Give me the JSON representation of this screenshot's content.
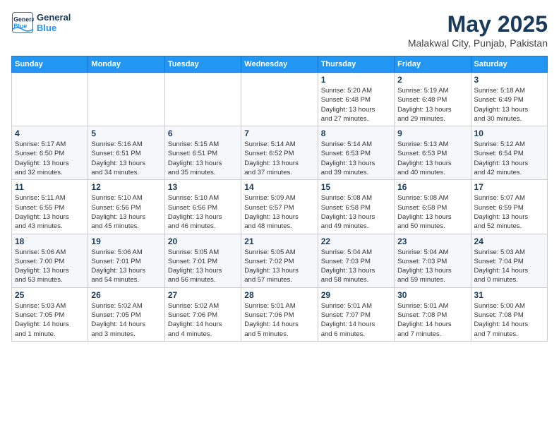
{
  "header": {
    "logo_line1": "General",
    "logo_line2": "Blue",
    "month": "May 2025",
    "location": "Malakwal City, Punjab, Pakistan"
  },
  "weekdays": [
    "Sunday",
    "Monday",
    "Tuesday",
    "Wednesday",
    "Thursday",
    "Friday",
    "Saturday"
  ],
  "weeks": [
    [
      {
        "num": "",
        "info": ""
      },
      {
        "num": "",
        "info": ""
      },
      {
        "num": "",
        "info": ""
      },
      {
        "num": "",
        "info": ""
      },
      {
        "num": "1",
        "info": "Sunrise: 5:20 AM\nSunset: 6:48 PM\nDaylight: 13 hours\nand 27 minutes."
      },
      {
        "num": "2",
        "info": "Sunrise: 5:19 AM\nSunset: 6:48 PM\nDaylight: 13 hours\nand 29 minutes."
      },
      {
        "num": "3",
        "info": "Sunrise: 5:18 AM\nSunset: 6:49 PM\nDaylight: 13 hours\nand 30 minutes."
      }
    ],
    [
      {
        "num": "4",
        "info": "Sunrise: 5:17 AM\nSunset: 6:50 PM\nDaylight: 13 hours\nand 32 minutes."
      },
      {
        "num": "5",
        "info": "Sunrise: 5:16 AM\nSunset: 6:51 PM\nDaylight: 13 hours\nand 34 minutes."
      },
      {
        "num": "6",
        "info": "Sunrise: 5:15 AM\nSunset: 6:51 PM\nDaylight: 13 hours\nand 35 minutes."
      },
      {
        "num": "7",
        "info": "Sunrise: 5:14 AM\nSunset: 6:52 PM\nDaylight: 13 hours\nand 37 minutes."
      },
      {
        "num": "8",
        "info": "Sunrise: 5:14 AM\nSunset: 6:53 PM\nDaylight: 13 hours\nand 39 minutes."
      },
      {
        "num": "9",
        "info": "Sunrise: 5:13 AM\nSunset: 6:53 PM\nDaylight: 13 hours\nand 40 minutes."
      },
      {
        "num": "10",
        "info": "Sunrise: 5:12 AM\nSunset: 6:54 PM\nDaylight: 13 hours\nand 42 minutes."
      }
    ],
    [
      {
        "num": "11",
        "info": "Sunrise: 5:11 AM\nSunset: 6:55 PM\nDaylight: 13 hours\nand 43 minutes."
      },
      {
        "num": "12",
        "info": "Sunrise: 5:10 AM\nSunset: 6:56 PM\nDaylight: 13 hours\nand 45 minutes."
      },
      {
        "num": "13",
        "info": "Sunrise: 5:10 AM\nSunset: 6:56 PM\nDaylight: 13 hours\nand 46 minutes."
      },
      {
        "num": "14",
        "info": "Sunrise: 5:09 AM\nSunset: 6:57 PM\nDaylight: 13 hours\nand 48 minutes."
      },
      {
        "num": "15",
        "info": "Sunrise: 5:08 AM\nSunset: 6:58 PM\nDaylight: 13 hours\nand 49 minutes."
      },
      {
        "num": "16",
        "info": "Sunrise: 5:08 AM\nSunset: 6:58 PM\nDaylight: 13 hours\nand 50 minutes."
      },
      {
        "num": "17",
        "info": "Sunrise: 5:07 AM\nSunset: 6:59 PM\nDaylight: 13 hours\nand 52 minutes."
      }
    ],
    [
      {
        "num": "18",
        "info": "Sunrise: 5:06 AM\nSunset: 7:00 PM\nDaylight: 13 hours\nand 53 minutes."
      },
      {
        "num": "19",
        "info": "Sunrise: 5:06 AM\nSunset: 7:01 PM\nDaylight: 13 hours\nand 54 minutes."
      },
      {
        "num": "20",
        "info": "Sunrise: 5:05 AM\nSunset: 7:01 PM\nDaylight: 13 hours\nand 56 minutes."
      },
      {
        "num": "21",
        "info": "Sunrise: 5:05 AM\nSunset: 7:02 PM\nDaylight: 13 hours\nand 57 minutes."
      },
      {
        "num": "22",
        "info": "Sunrise: 5:04 AM\nSunset: 7:03 PM\nDaylight: 13 hours\nand 58 minutes."
      },
      {
        "num": "23",
        "info": "Sunrise: 5:04 AM\nSunset: 7:03 PM\nDaylight: 13 hours\nand 59 minutes."
      },
      {
        "num": "24",
        "info": "Sunrise: 5:03 AM\nSunset: 7:04 PM\nDaylight: 14 hours\nand 0 minutes."
      }
    ],
    [
      {
        "num": "25",
        "info": "Sunrise: 5:03 AM\nSunset: 7:05 PM\nDaylight: 14 hours\nand 1 minute."
      },
      {
        "num": "26",
        "info": "Sunrise: 5:02 AM\nSunset: 7:05 PM\nDaylight: 14 hours\nand 3 minutes."
      },
      {
        "num": "27",
        "info": "Sunrise: 5:02 AM\nSunset: 7:06 PM\nDaylight: 14 hours\nand 4 minutes."
      },
      {
        "num": "28",
        "info": "Sunrise: 5:01 AM\nSunset: 7:06 PM\nDaylight: 14 hours\nand 5 minutes."
      },
      {
        "num": "29",
        "info": "Sunrise: 5:01 AM\nSunset: 7:07 PM\nDaylight: 14 hours\nand 6 minutes."
      },
      {
        "num": "30",
        "info": "Sunrise: 5:01 AM\nSunset: 7:08 PM\nDaylight: 14 hours\nand 7 minutes."
      },
      {
        "num": "31",
        "info": "Sunrise: 5:00 AM\nSunset: 7:08 PM\nDaylight: 14 hours\nand 7 minutes."
      }
    ]
  ]
}
